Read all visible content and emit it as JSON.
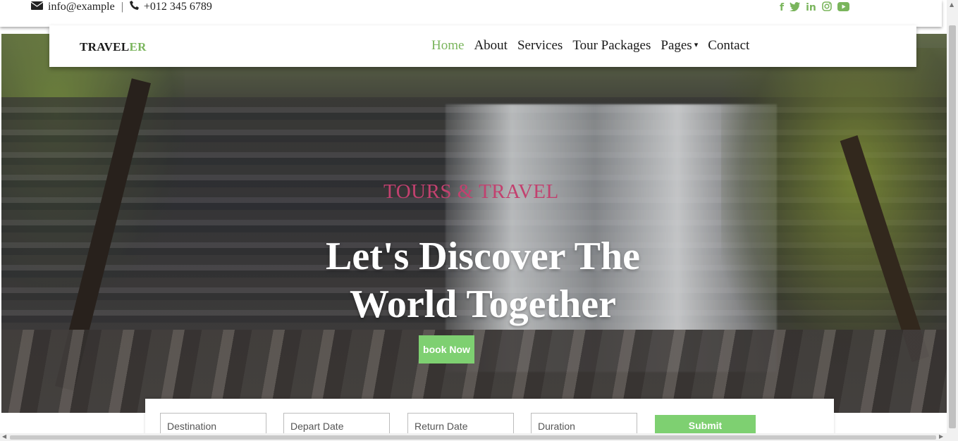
{
  "topbar": {
    "email": "info@example",
    "separator": "|",
    "phone": "+012 345 6789",
    "email_icon": "envelope-icon",
    "phone_icon": "phone-icon",
    "social": [
      "facebook-icon",
      "twitter-icon",
      "linkedin-icon",
      "instagram-icon",
      "youtube-icon"
    ],
    "social_glyphs": [
      "f",
      "🐦",
      "in",
      "◎",
      "▶"
    ]
  },
  "brand": {
    "part1": "TRAVEL",
    "part2": "ER"
  },
  "nav": {
    "items": [
      "Home",
      "About",
      "Services",
      "Tour Packages",
      "Pages",
      "Contact"
    ],
    "active": "Home",
    "caret": "▾"
  },
  "hero": {
    "kicker": "TOURS & TRAVEL",
    "headline": "Let's Discover The World Together",
    "button": "book Now"
  },
  "booking": {
    "destination_placeholder": "Destination",
    "depart_placeholder": "Depart Date",
    "return_placeholder": "Return Date",
    "duration_placeholder": "Duration",
    "submit": "Submit"
  },
  "colors": {
    "accent": "#7ab55c",
    "button": "#7ed071",
    "kicker": "#c2416f"
  }
}
